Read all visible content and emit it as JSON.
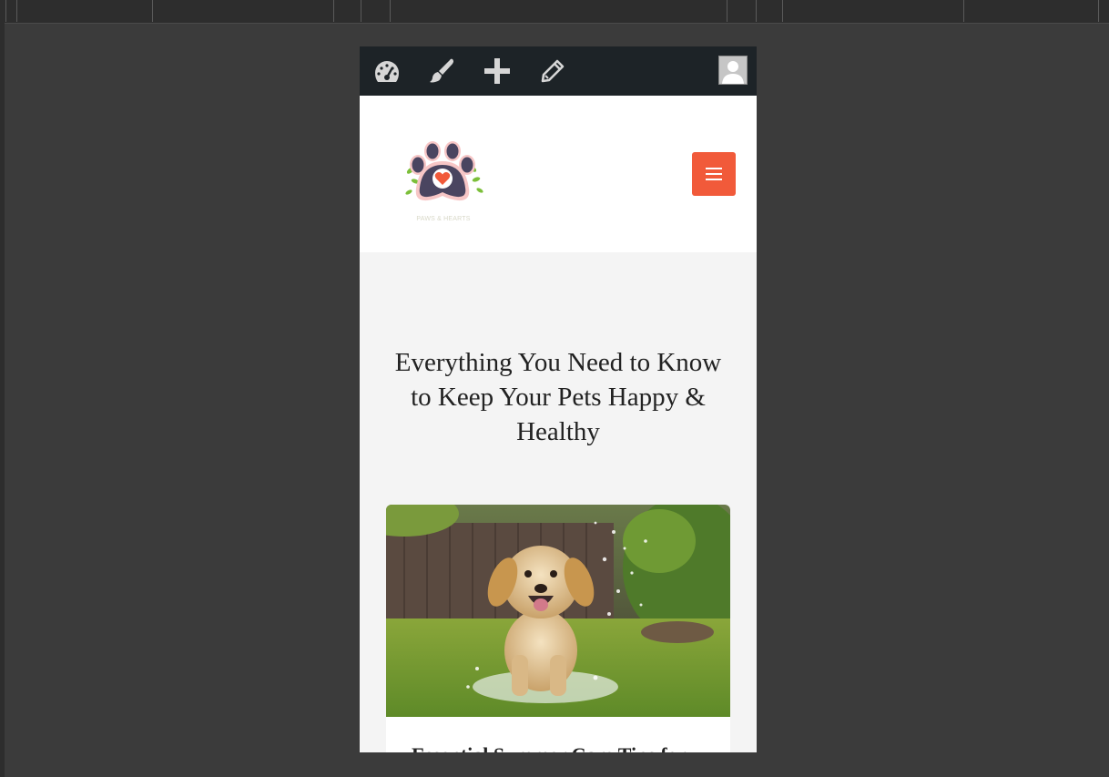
{
  "admin_bar": {
    "icons": [
      "dashboard-icon",
      "customize-brush-icon",
      "new-content-plus-icon",
      "edit-pencil-icon"
    ],
    "avatar": "user-avatar"
  },
  "site": {
    "logo_icon": "paw-heart-logo",
    "logo_caption": "PAWS & HEARTS",
    "menu_icon": "hamburger-icon"
  },
  "hero": {
    "title": "Everything You Need to Know to Keep Your Pets Happy & Healthy"
  },
  "posts": [
    {
      "image": "golden-retriever-puppy-running-in-water-spray",
      "title": "Essential Summer Care Tips for"
    }
  ],
  "colors": {
    "admin_bar_bg": "#1d2327",
    "menu_button": "#f15a3a",
    "page_bg": "#f4f4f4",
    "chrome_bg": "#3b3b3b"
  }
}
